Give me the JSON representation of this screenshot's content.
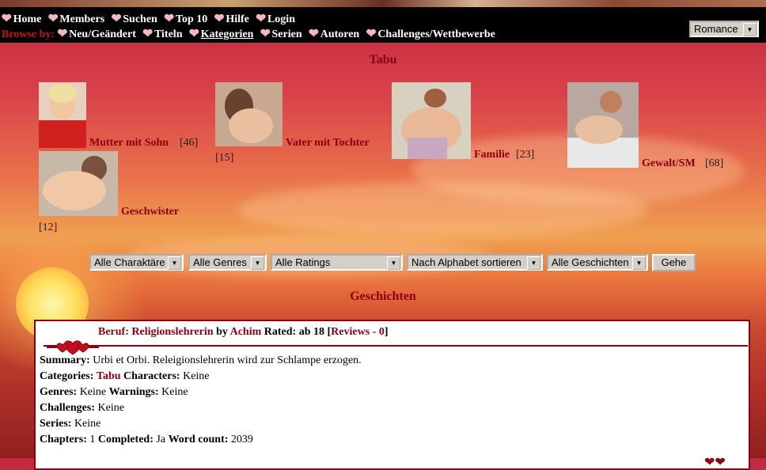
{
  "nav": {
    "top_items": [
      {
        "label": "Home",
        "icon": "heart-icon"
      },
      {
        "label": "Members",
        "icon": "heart-icon"
      },
      {
        "label": "Suchen",
        "icon": "heart-icon"
      },
      {
        "label": "Top 10",
        "icon": "heart-icon"
      },
      {
        "label": "Hilfe",
        "icon": "heart-icon"
      },
      {
        "label": "Login",
        "icon": "heart-icon"
      }
    ],
    "browse_label": "Browse by:",
    "browse_items": [
      {
        "label": "Neu/Geändert"
      },
      {
        "label": "Titeln"
      },
      {
        "label": "Kategorien"
      },
      {
        "label": "Serien"
      },
      {
        "label": "Autoren"
      },
      {
        "label": "Challenges/Wettbewerbe"
      }
    ],
    "skin_select": "Romance"
  },
  "page_title": "Tabu",
  "categories": [
    {
      "name": "Mutter mit Sohn",
      "count": "[46]"
    },
    {
      "name": "Vater mit Tochter",
      "count": "[15]"
    },
    {
      "name": "Familie",
      "count": "[23]"
    },
    {
      "name": "Gewalt/SM",
      "count": "[68]"
    },
    {
      "name": "Geschwister",
      "count": "[12]"
    }
  ],
  "filters": {
    "characters": "Alle Charaktäre",
    "genres": "Alle Genres",
    "ratings": "Alle Ratings",
    "sort": "Nach Alphabet sortieren",
    "stories": "Alle Geschichten",
    "go_label": "Gehe"
  },
  "section_title": "Geschichten",
  "story": {
    "title": "Beruf: Religionslehrerin",
    "by": "by",
    "author": "Achim",
    "rated_label": "Rated:",
    "rated_value": "ab 18",
    "reviews_open": "[",
    "reviews_label": "Reviews - 0",
    "reviews_close": "]",
    "summary_label": "Summary:",
    "summary": "Urbi et Orbi. Releigionslehrerin wird zur Schlampe erzogen.",
    "categories_label": "Categories:",
    "categories": "Tabu",
    "characters_label": "Characters:",
    "characters": "Keine",
    "genres_label": "Genres:",
    "genres": "Keine",
    "warnings_label": "Warnings:",
    "warnings": "Keine",
    "challenges_label": "Challenges:",
    "challenges": "Keine",
    "series_label": "Series:",
    "series": "Keine",
    "chapters_label": "Chapters:",
    "chapters": "1",
    "completed_label": "Completed:",
    "completed": "Ja",
    "wordcount_label": "Word count:",
    "wordcount": "2039"
  },
  "colors": {
    "accent": "#8a0010",
    "navbar": "#000000",
    "browse_label": "#c81020"
  }
}
